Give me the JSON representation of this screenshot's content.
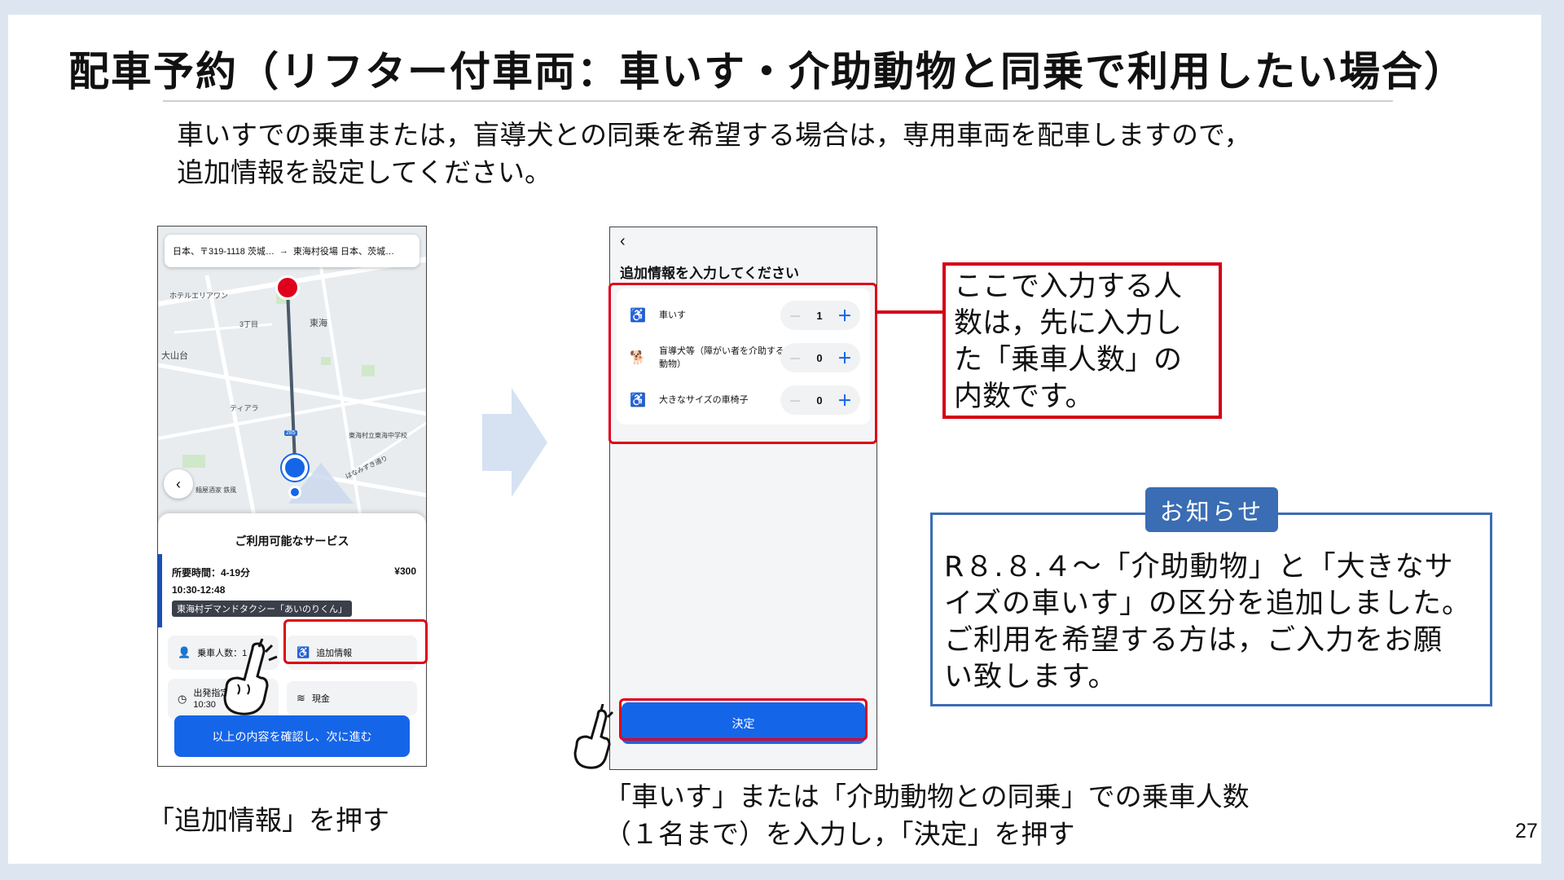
{
  "slide": {
    "title": "配車予約（リフター付車両：車いす・介助動物と同乗で利用したい場合）",
    "intro_line1": "車いすでの乗車または，盲導犬との同乗を希望する場合は，専用車両を配車しますので，",
    "intro_line2": "追加情報を設定してください。",
    "caption_left": "「追加情報」を押す",
    "caption_right_line1": "「車いす」または「介助動物との同乗」での乗車人数",
    "caption_right_line2": "（１名まで）を入力し，「決定」を押す",
    "page_number": "27"
  },
  "phone1": {
    "search_from": "日本、〒319-1118 茨城…",
    "search_arrow": "→",
    "search_to": "東海村役場 日本、茨城…",
    "map_labels": {
      "hotel": "ホテルエリアワン",
      "chome": "3丁目",
      "tokai": "東海",
      "oyamadai": "大山台",
      "tiara": "ティアラ",
      "school": "東海村立東海中学校",
      "izakaya": "麺屋酒家 鉄風",
      "street": "はなみずき通り",
      "route": "285"
    },
    "back_icon": "‹",
    "sheet_title": "ご利用可能なサービス",
    "service": {
      "duration": "所要時間：4-19分",
      "price": "¥300",
      "time": "10:30-12:48",
      "name": "東海村デマンドタクシー「あいのりくん」"
    },
    "options": {
      "passengers": "乗車人数：1",
      "additional_info": "追加情報",
      "departure": "出発指定",
      "departure_time": "10:30",
      "departure_suffix": "日",
      "payment": "現金"
    },
    "next_button": "以上の内容を確認し、次に進む"
  },
  "phone2": {
    "back_icon": "‹",
    "title": "追加情報を入力してください",
    "rows": [
      {
        "icon": "wheelchair-icon",
        "label": "車いす",
        "value": "1"
      },
      {
        "icon": "guide-dog-icon",
        "label": "盲導犬等（障がい者を介助する動物）",
        "value": "0"
      },
      {
        "icon": "wheelchair-icon",
        "label": "大きなサイズの車椅子",
        "value": "0"
      }
    ],
    "minus": "－",
    "plus": "＋",
    "confirm_button": "決定"
  },
  "note": {
    "text_line1": "ここで入力する人",
    "text_line2": "数は，先に入力し",
    "text_line3": "た「乗車人数」の",
    "text_line4": "内数です。"
  },
  "info": {
    "label": "お知らせ",
    "line1": "R８.８.４～「介助動物」と「大きなサ",
    "line2": "イズの車いす」の区分を追加しました。",
    "line3": "ご利用を希望する方は，ご入力をお願",
    "line4": "い致します。"
  },
  "colors": {
    "accent_blue": "#1565e8",
    "highlight_red": "#e0001b",
    "info_blue": "#3a6db3",
    "arrow_blue": "#d6e2f2"
  }
}
